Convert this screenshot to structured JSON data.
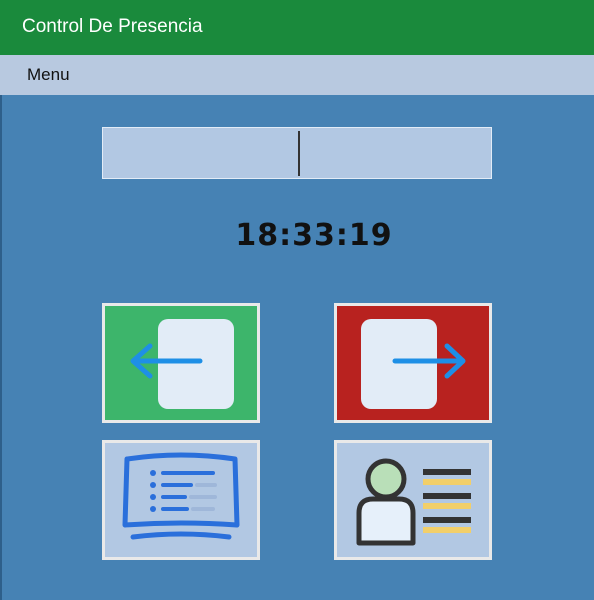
{
  "window": {
    "title": "Control De Presencia"
  },
  "menubar": {
    "items": [
      {
        "label": "Menu"
      }
    ]
  },
  "field": {
    "value": ""
  },
  "clock": {
    "time": "18:33:19"
  },
  "tiles": [
    {
      "name": "check-in",
      "icon": "door-enter-arrow-left-icon",
      "color": "#3db56b"
    },
    {
      "name": "check-out",
      "icon": "door-exit-arrow-right-icon",
      "color": "#b8221f"
    },
    {
      "name": "list",
      "icon": "monitor-list-icon",
      "color": "#b2c8e3"
    },
    {
      "name": "users",
      "icon": "user-list-icon",
      "color": "#b2c8e3"
    }
  ],
  "colors": {
    "titlebar": "#1a8a3c",
    "menubar": "#b8c9e0",
    "background": "#4682b4",
    "arrow": "#1e8fe6"
  }
}
